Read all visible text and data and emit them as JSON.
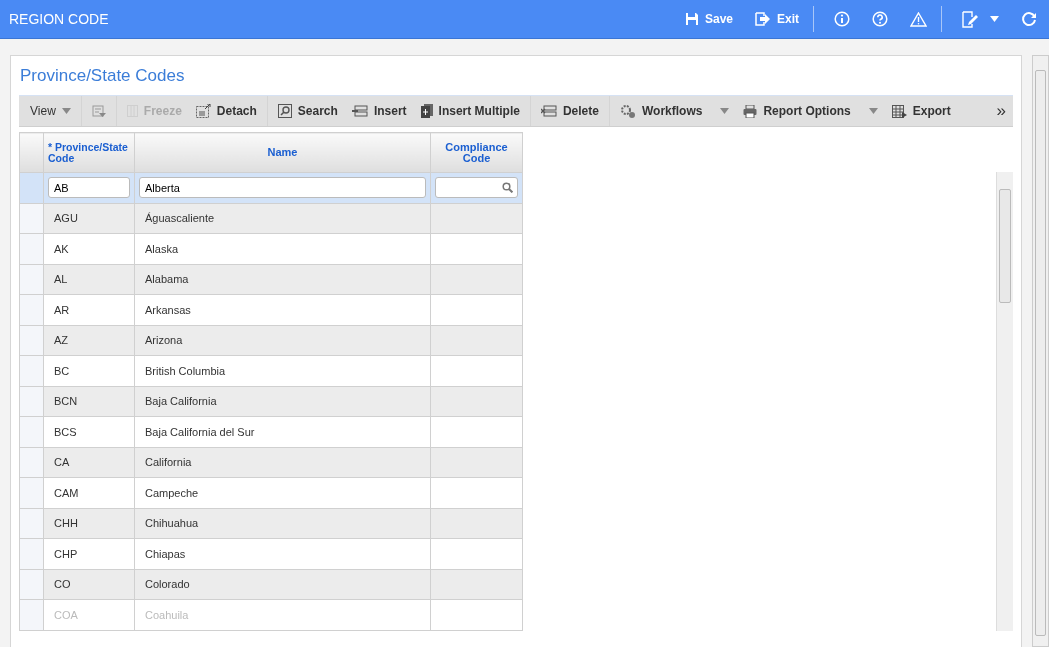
{
  "window": {
    "title": "REGION CODE"
  },
  "header_actions": [
    {
      "kind": "save",
      "label": "Save"
    },
    {
      "kind": "exit",
      "label": "Exit"
    },
    {
      "kind": "info"
    },
    {
      "kind": "help"
    },
    {
      "kind": "warning"
    },
    {
      "kind": "edit",
      "dropdown": true
    },
    {
      "kind": "refresh"
    }
  ],
  "panel": {
    "title": "Province/State Codes"
  },
  "toolbar": [
    {
      "kind": "view",
      "label": "View",
      "dropdown": true,
      "disabled": false
    },
    {
      "kind": "filter",
      "disabled": false
    },
    {
      "kind": "freeze",
      "label": "Freeze",
      "disabled": true
    },
    {
      "kind": "detach",
      "label": "Detach",
      "disabled": false
    },
    {
      "kind": "search",
      "label": "Search",
      "disabled": false
    },
    {
      "kind": "insert",
      "label": "Insert",
      "disabled": false
    },
    {
      "kind": "insert-multiple",
      "label": "Insert Multiple",
      "disabled": false
    },
    {
      "kind": "delete",
      "label": "Delete",
      "disabled": false
    },
    {
      "kind": "workflows",
      "label": "Workflows",
      "dropdown": true,
      "disabled": false
    },
    {
      "kind": "print",
      "label": "Report Options",
      "dropdown": true,
      "disabled": false
    },
    {
      "kind": "export",
      "label": "Export",
      "disabled": false
    },
    {
      "kind": "more",
      "label": "»",
      "disabled": false
    }
  ],
  "table": {
    "columns": [
      {
        "label": "* Province/State Code",
        "required": true
      },
      {
        "label": "Name",
        "required": false
      },
      {
        "label": "Compliance Code",
        "required": false
      }
    ],
    "edit_row": {
      "code": "AB",
      "name": "Alberta"
    },
    "rows": [
      {
        "code": "AGU",
        "name": "Águascaliente"
      },
      {
        "code": "AK",
        "name": "Alaska"
      },
      {
        "code": "AL",
        "name": "Alabama"
      },
      {
        "code": "AR",
        "name": "Arkansas"
      },
      {
        "code": "AZ",
        "name": "Arizona"
      },
      {
        "code": "BC",
        "name": "British Columbia"
      },
      {
        "code": "BCN",
        "name": "Baja California"
      },
      {
        "code": "BCS",
        "name": "Baja California del Sur"
      },
      {
        "code": "CA",
        "name": "California"
      },
      {
        "code": "CAM",
        "name": "Campeche"
      },
      {
        "code": "CHH",
        "name": "Chihuahua"
      },
      {
        "code": "CHP",
        "name": "Chiapas"
      },
      {
        "code": "CO",
        "name": "Colorado"
      },
      {
        "code": "COA",
        "name": "Coahuila"
      }
    ]
  }
}
